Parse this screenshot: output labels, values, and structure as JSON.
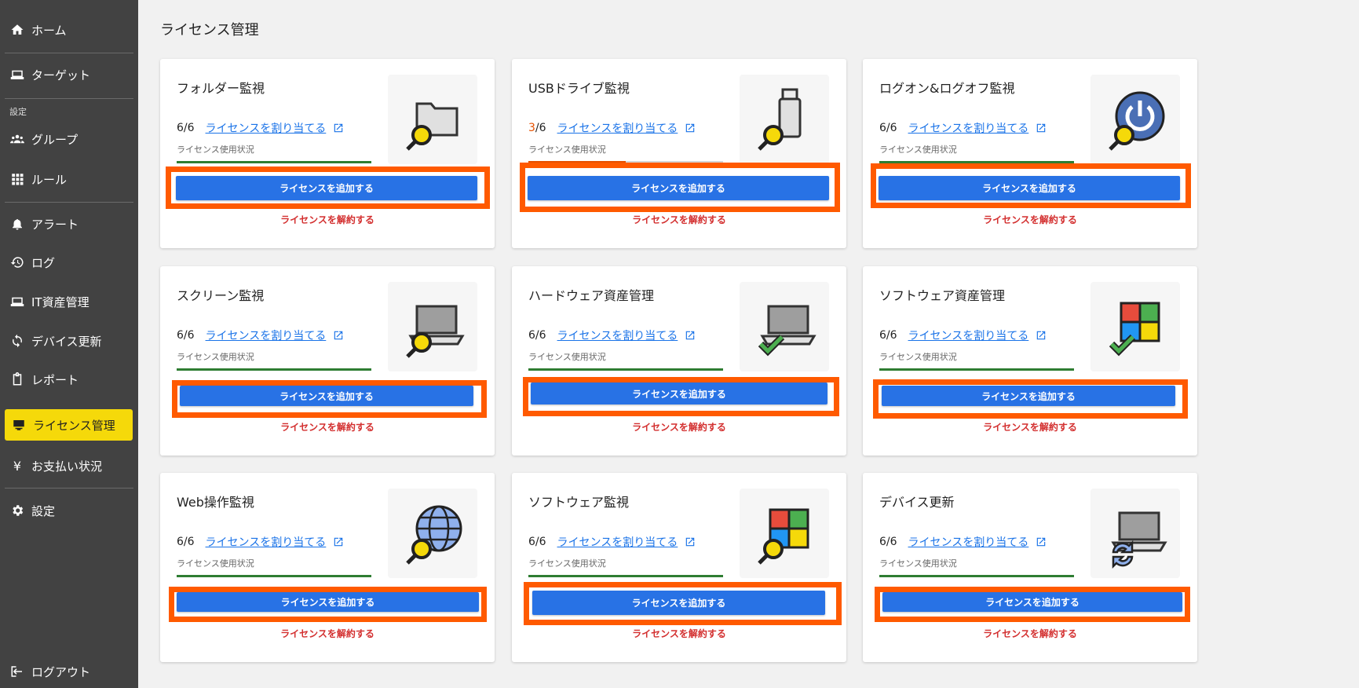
{
  "sidebar": {
    "items": [
      {
        "label": "ホーム",
        "icon": "home-icon"
      },
      {
        "label": "ターゲット",
        "icon": "laptop-icon"
      },
      {
        "label": "グループ",
        "icon": "group-icon"
      },
      {
        "label": "ルール",
        "icon": "grid-icon"
      },
      {
        "label": "アラート",
        "icon": "bell-icon"
      },
      {
        "label": "ログ",
        "icon": "history-icon"
      },
      {
        "label": "IT資産管理",
        "icon": "laptop-icon"
      },
      {
        "label": "デバイス更新",
        "icon": "sync-icon"
      },
      {
        "label": "レポート",
        "icon": "clipboard-icon"
      },
      {
        "label": "ライセンス管理",
        "icon": "card-icon"
      },
      {
        "label": "お支払い状況",
        "icon": "yen-icon"
      },
      {
        "label": "設定",
        "icon": "gear-icon"
      },
      {
        "label": "ログアウト",
        "icon": "logout-icon"
      }
    ],
    "settings_section_label": "設定",
    "active_item": "ライセンス管理",
    "active_color": "#f5d90a"
  },
  "main": {
    "title": "ライセンス管理",
    "common": {
      "assign_link": "ライセンスを割り当てる",
      "usage_label": "ライセンス使用状況",
      "add_button": "ライセンスを追加する",
      "release_link": "ライセンスを解約する"
    },
    "cards": [
      {
        "title": "フォルダー監視",
        "used": "6",
        "total": "/6",
        "usage_fraction": 1.0,
        "icon": "folder-search-icon"
      },
      {
        "title": "USBドライブ監視",
        "used": "3",
        "total": "/6",
        "usage_fraction": 0.5,
        "icon": "usb-search-icon"
      },
      {
        "title": "ログオン&ログオフ監視",
        "used": "6",
        "total": "/6",
        "usage_fraction": 1.0,
        "icon": "power-search-icon"
      },
      {
        "title": "スクリーン監視",
        "used": "6",
        "total": "/6",
        "usage_fraction": 1.0,
        "icon": "laptop-search-icon"
      },
      {
        "title": "ハードウェア資産管理",
        "used": "6",
        "total": "/6",
        "usage_fraction": 1.0,
        "icon": "laptop-check-icon"
      },
      {
        "title": "ソフトウェア資産管理",
        "used": "6",
        "total": "/6",
        "usage_fraction": 1.0,
        "icon": "windows-check-icon"
      },
      {
        "title": "Web操作監視",
        "used": "6",
        "total": "/6",
        "usage_fraction": 1.0,
        "icon": "globe-search-icon"
      },
      {
        "title": "ソフトウェア監視",
        "used": "6",
        "total": "/6",
        "usage_fraction": 1.0,
        "icon": "windows-search-icon"
      },
      {
        "title": "デバイス更新",
        "used": "6",
        "total": "/6",
        "usage_fraction": 1.0,
        "icon": "laptop-sync-icon"
      }
    ]
  },
  "colors": {
    "primary_button": "#2872e5",
    "highlight_border": "#ff5a00",
    "release_text": "#d32f2f",
    "usage_bar": "#2e7d32",
    "warning_count": "#e65100",
    "sidebar_bg": "#424242"
  }
}
